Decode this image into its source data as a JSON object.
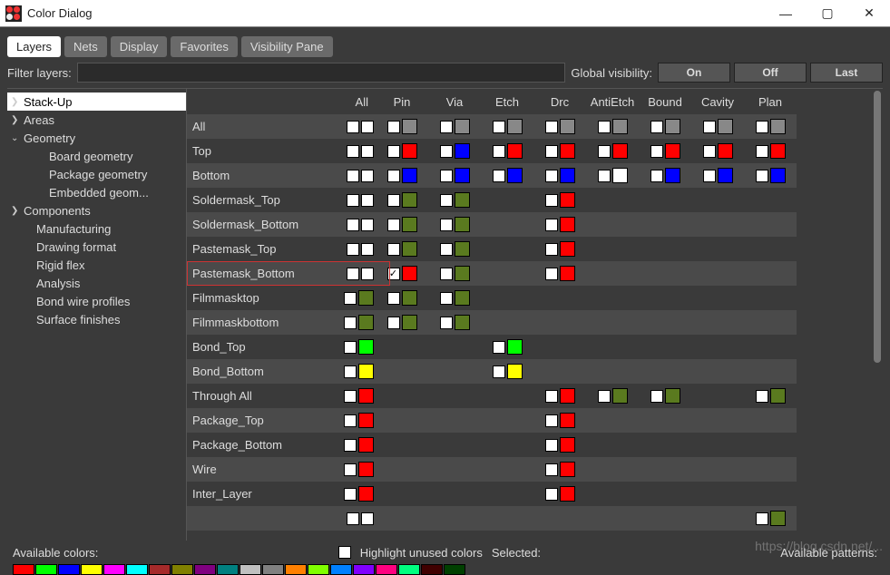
{
  "window": {
    "title": "Color Dialog",
    "buttons": {
      "min": "—",
      "max": "▢",
      "close": "✕"
    }
  },
  "tabs": [
    "Layers",
    "Nets",
    "Display",
    "Favorites",
    "Visibility Pane"
  ],
  "active_tab": 0,
  "filter": {
    "label": "Filter layers:",
    "value": ""
  },
  "global_vis": {
    "label": "Global visibility:",
    "buttons": [
      "On",
      "Off",
      "Last"
    ]
  },
  "tree": [
    {
      "label": "Stack-Up",
      "arrow": ">",
      "selected": true,
      "depth": 0
    },
    {
      "label": "Areas",
      "arrow": ">",
      "depth": 0
    },
    {
      "label": "Geometry",
      "arrow": "v",
      "depth": 0
    },
    {
      "label": "Board geometry",
      "depth": 2
    },
    {
      "label": "Package geometry",
      "depth": 2
    },
    {
      "label": "Embedded geom...",
      "depth": 2
    },
    {
      "label": "Components",
      "arrow": ">",
      "depth": 0
    },
    {
      "label": "Manufacturing",
      "depth": 1
    },
    {
      "label": "Drawing format",
      "depth": 1
    },
    {
      "label": "Rigid flex",
      "depth": 1
    },
    {
      "label": "Analysis",
      "depth": 1
    },
    {
      "label": "Bond wire profiles",
      "depth": 1
    },
    {
      "label": "Surface finishes",
      "depth": 1
    }
  ],
  "columns": [
    "All",
    "Pin",
    "Via",
    "Etch",
    "Drc",
    "AntiEtch",
    "Bound",
    "Cavity",
    "Plan"
  ],
  "rows": [
    {
      "label": "All",
      "all": [
        "cb",
        "cb"
      ],
      "cells": [
        {
          "cb": true,
          "sw": "#888"
        },
        {
          "cb": true,
          "sw": "#888"
        },
        {
          "cb": true,
          "sw": "#888"
        },
        {
          "cb": true,
          "sw": "#888"
        },
        {
          "cb": true,
          "sw": "#888"
        },
        {
          "cb": true,
          "sw": "#888"
        },
        {
          "cb": true,
          "sw": "#888"
        },
        {
          "cb": true,
          "sw": "#888"
        }
      ]
    },
    {
      "label": "Top",
      "all": [
        "cb",
        "cb"
      ],
      "cells": [
        {
          "cb": true,
          "sw": "#f00"
        },
        {
          "cb": true,
          "sw": "#00f"
        },
        {
          "cb": true,
          "sw": "#f00"
        },
        {
          "cb": true,
          "sw": "#f00"
        },
        {
          "cb": true,
          "sw": "#f00"
        },
        {
          "cb": true,
          "sw": "#f00"
        },
        {
          "cb": true,
          "sw": "#f00"
        },
        {
          "cb": true,
          "sw": "#f00"
        }
      ]
    },
    {
      "label": "Bottom",
      "all": [
        "cb",
        "cb"
      ],
      "cells": [
        {
          "cb": true,
          "sw": "#00f"
        },
        {
          "cb": true,
          "sw": "#00f"
        },
        {
          "cb": true,
          "sw": "#00f"
        },
        {
          "cb": true,
          "sw": "#00f"
        },
        {
          "cb": true,
          "sw": "#fff"
        },
        {
          "cb": true,
          "sw": "#00f"
        },
        {
          "cb": true,
          "sw": "#00f"
        },
        {
          "cb": true,
          "sw": "#00f"
        }
      ]
    },
    {
      "label": "Soldermask_Top",
      "all": [
        "cb",
        "cb"
      ],
      "cells": [
        {
          "cb": true,
          "sw": "#5a7a1f"
        },
        {
          "cb": true,
          "sw": "#5a7a1f"
        },
        null,
        {
          "cb": true,
          "sw": "#f00"
        },
        null,
        null,
        null,
        null
      ]
    },
    {
      "label": "Soldermask_Bottom",
      "all": [
        "cb",
        "cb"
      ],
      "cells": [
        {
          "cb": true,
          "sw": "#5a7a1f"
        },
        {
          "cb": true,
          "sw": "#5a7a1f"
        },
        null,
        {
          "cb": true,
          "sw": "#f00"
        },
        null,
        null,
        null,
        null
      ]
    },
    {
      "label": "Pastemask_Top",
      "all": [
        "cb",
        "cb"
      ],
      "cells": [
        {
          "cb": true,
          "sw": "#5a7a1f"
        },
        {
          "cb": true,
          "sw": "#5a7a1f"
        },
        null,
        {
          "cb": true,
          "sw": "#f00"
        },
        null,
        null,
        null,
        null
      ]
    },
    {
      "label": "Pastemask_Bottom",
      "all": [
        "cb",
        "cb"
      ],
      "highlight": true,
      "cells": [
        {
          "cb": true,
          "checked": true,
          "sw": "#f00"
        },
        {
          "cb": true,
          "sw": "#5a7a1f"
        },
        null,
        {
          "cb": true,
          "sw": "#f00"
        },
        null,
        null,
        null,
        null
      ]
    },
    {
      "label": "Filmmasktop",
      "all": [
        "cb",
        "sw:#5a7a1f"
      ],
      "cells": [
        {
          "cb": true,
          "sw": "#5a7a1f"
        },
        {
          "cb": true,
          "sw": "#5a7a1f"
        },
        null,
        null,
        null,
        null,
        null,
        null
      ]
    },
    {
      "label": "Filmmaskbottom",
      "all": [
        "cb",
        "sw:#5a7a1f"
      ],
      "cells": [
        {
          "cb": true,
          "sw": "#5a7a1f"
        },
        {
          "cb": true,
          "sw": "#5a7a1f"
        },
        null,
        null,
        null,
        null,
        null,
        null
      ]
    },
    {
      "label": "Bond_Top",
      "all": [
        "cb",
        "sw:#0f0"
      ],
      "cells": [
        null,
        null,
        {
          "cb": true,
          "sw": "#0f0"
        },
        null,
        null,
        null,
        null,
        null
      ]
    },
    {
      "label": "Bond_Bottom",
      "all": [
        "cb",
        "sw:#ff0"
      ],
      "cells": [
        null,
        null,
        {
          "cb": true,
          "sw": "#ff0"
        },
        null,
        null,
        null,
        null,
        null
      ]
    },
    {
      "label": "Through All",
      "all": [
        "cb",
        "sw:#f00"
      ],
      "cells": [
        null,
        null,
        null,
        {
          "cb": true,
          "sw": "#f00"
        },
        {
          "cb": true,
          "sw": "#5a7a1f"
        },
        {
          "cb": true,
          "sw": "#5a7a1f"
        },
        null,
        {
          "cb": true,
          "sw": "#5a7a1f"
        }
      ]
    },
    {
      "label": "Package_Top",
      "all": [
        "cb",
        "sw:#f00"
      ],
      "cells": [
        null,
        null,
        null,
        {
          "cb": true,
          "sw": "#f00"
        },
        null,
        null,
        null,
        null
      ]
    },
    {
      "label": "Package_Bottom",
      "all": [
        "cb",
        "sw:#f00"
      ],
      "cells": [
        null,
        null,
        null,
        {
          "cb": true,
          "sw": "#f00"
        },
        null,
        null,
        null,
        null
      ]
    },
    {
      "label": "Wire",
      "all": [
        "cb",
        "sw:#f00"
      ],
      "cells": [
        null,
        null,
        null,
        {
          "cb": true,
          "sw": "#f00"
        },
        null,
        null,
        null,
        null
      ]
    },
    {
      "label": "Inter_Layer",
      "all": [
        "cb",
        "sw:#f00"
      ],
      "cells": [
        null,
        null,
        null,
        {
          "cb": true,
          "sw": "#f00"
        },
        null,
        null,
        null,
        null
      ]
    },
    {
      "label": "",
      "all": [
        "cb",
        "cb"
      ],
      "cells": [
        null,
        null,
        null,
        null,
        null,
        null,
        null,
        {
          "cb": true,
          "sw": "#5a7a1f"
        }
      ]
    }
  ],
  "footer": {
    "available_colors": "Available colors:",
    "highlight_unused": "Highlight unused colors",
    "selected": "Selected:",
    "available_patterns": "Available patterns:"
  },
  "palette": [
    "#f00",
    "#0f0",
    "#00f",
    "#ff0",
    "#f0f",
    "#0ff",
    "#a52a2a",
    "#808000",
    "#800080",
    "#008080",
    "#c0c0c0",
    "#808080",
    "#ff8000",
    "#80ff00",
    "#0080ff",
    "#8000ff",
    "#ff0080",
    "#00ff80",
    "#400000",
    "#004000"
  ],
  "watermark": "https://blog.csdn.net/..."
}
